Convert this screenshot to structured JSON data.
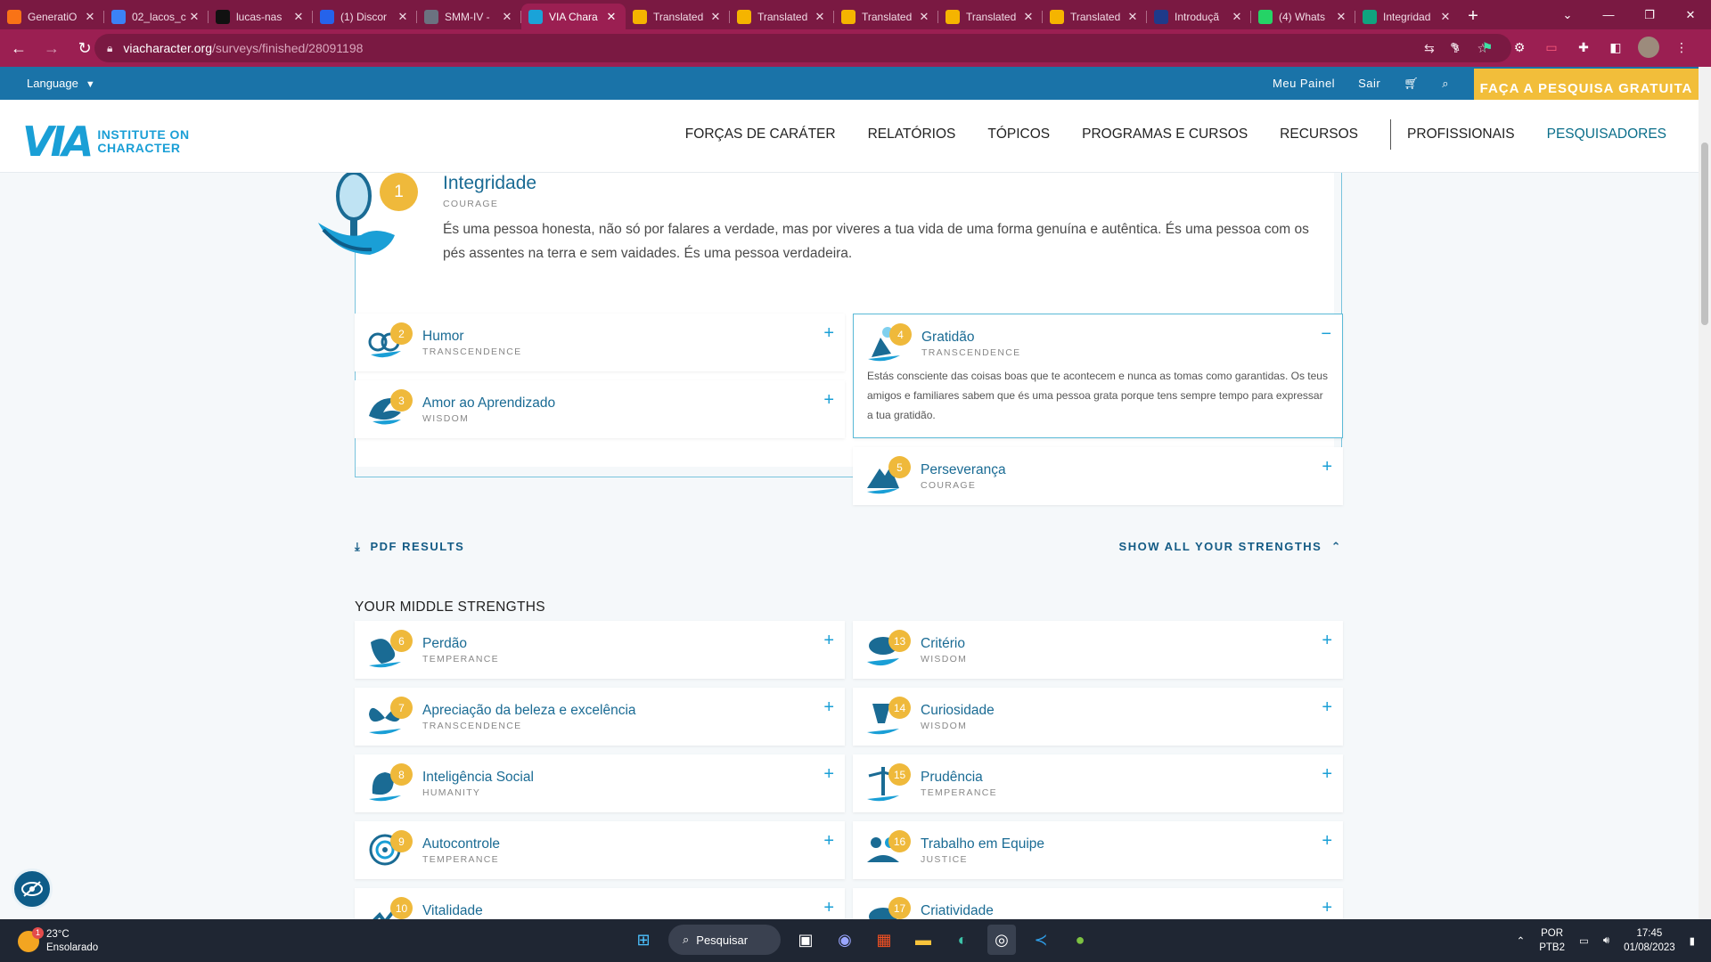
{
  "browser": {
    "tabs": [
      {
        "label": "GeneratiO",
        "color": "#f97316"
      },
      {
        "label": "02_lacos_c",
        "color": "#3b82f6"
      },
      {
        "label": "lucas-nas",
        "color": "#111111"
      },
      {
        "label": "(1) Discor",
        "color": "#2563eb"
      },
      {
        "label": "SMM-IV -",
        "color": "#6b7280"
      },
      {
        "label": "VIA Chara",
        "color": "#1aa3d8"
      },
      {
        "label": "Translated",
        "color": "#f5b400"
      },
      {
        "label": "Translated",
        "color": "#f5b400"
      },
      {
        "label": "Translated",
        "color": "#f5b400"
      },
      {
        "label": "Translated",
        "color": "#f5b400"
      },
      {
        "label": "Translated",
        "color": "#f5b400"
      },
      {
        "label": "Introduçã",
        "color": "#1e3a8a"
      },
      {
        "label": "(4) Whats",
        "color": "#25d366"
      },
      {
        "label": "Integridad",
        "color": "#10a37f"
      }
    ],
    "url_host": "viacharacter.org",
    "url_path": "/surveys/finished/28091198"
  },
  "site": {
    "language_label": "Language",
    "top_links": [
      "Meu Painel",
      "Sair"
    ],
    "cta": "FAÇA A PESQUISA GRATUITA",
    "logo_mark": "VIA",
    "logo_tag_1": "INSTITUTE ON",
    "logo_tag_2": "CHARACTER",
    "nav": [
      "FORÇAS DE CARÁTER",
      "RELATÓRIOS",
      "TÓPICOS",
      "PROGRAMAS E CURSOS",
      "RECURSOS",
      "PROFISSIONAIS",
      "PESQUISADORES"
    ]
  },
  "top_strength": {
    "rank": "1",
    "name": "Integridade",
    "virtue": "COURAGE",
    "description": "És uma pessoa honesta, não só por falares a verdade, mas por viveres a tua vida de uma forma genuína e autêntica. És uma pessoa com os pés assentes na terra e sem vaidades. És uma pessoa verdadeira."
  },
  "signature": [
    {
      "rank": "2",
      "name": "Humor",
      "virtue": "TRANSCENDENCE",
      "icon": "humor-icon"
    },
    {
      "rank": "3",
      "name": "Amor ao Aprendizado",
      "virtue": "WISDOM",
      "icon": "love-of-learning-icon"
    },
    {
      "rank": "4",
      "name": "Gratidão",
      "virtue": "TRANSCENDENCE",
      "icon": "gratitude-icon",
      "description": "Estás consciente das coisas boas que te acontecem e nunca as tomas como garantidas. Os teus amigos e familiares sabem que és uma pessoa grata porque tens sempre tempo para expressar a tua gratidão."
    },
    {
      "rank": "5",
      "name": "Perseverança",
      "virtue": "COURAGE",
      "icon": "perseverance-icon"
    }
  ],
  "actions": {
    "pdf": "PDF RESULTS",
    "show_all": "SHOW ALL YOUR STRENGTHS"
  },
  "middle_title": "YOUR MIDDLE STRENGTHS",
  "middle": [
    {
      "rank": "6",
      "name": "Perdão",
      "virtue": "TEMPERANCE"
    },
    {
      "rank": "13",
      "name": "Critério",
      "virtue": "WISDOM"
    },
    {
      "rank": "7",
      "name": "Apreciação da beleza e excelência",
      "virtue": "TRANSCENDENCE"
    },
    {
      "rank": "14",
      "name": "Curiosidade",
      "virtue": "WISDOM"
    },
    {
      "rank": "8",
      "name": "Inteligência Social",
      "virtue": "HUMANITY"
    },
    {
      "rank": "15",
      "name": "Prudência",
      "virtue": "TEMPERANCE"
    },
    {
      "rank": "9",
      "name": "Autocontrole",
      "virtue": "TEMPERANCE"
    },
    {
      "rank": "16",
      "name": "Trabalho em Equipe",
      "virtue": "JUSTICE"
    },
    {
      "rank": "10",
      "name": "Vitalidade",
      "virtue": ""
    },
    {
      "rank": "17",
      "name": "Criatividade",
      "virtue": ""
    }
  ],
  "taskbar": {
    "temp": "23°C",
    "weather": "Ensolarado",
    "weather_badge": "1",
    "search": "Pesquisar",
    "lang_1": "POR",
    "lang_2": "PTB2",
    "time": "17:45",
    "date": "01/08/2023"
  }
}
